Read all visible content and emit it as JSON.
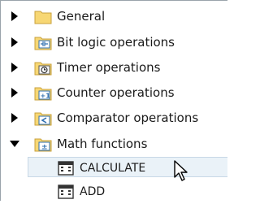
{
  "tree": {
    "items": [
      {
        "label": "General",
        "expanded": false,
        "icon": "folder-icon"
      },
      {
        "label": "Bit logic operations",
        "expanded": false,
        "icon": "bit-logic-icon"
      },
      {
        "label": "Timer operations",
        "expanded": false,
        "icon": "timer-icon"
      },
      {
        "label": "Counter operations",
        "expanded": false,
        "icon": "counter-icon"
      },
      {
        "label": "Comparator operations",
        "expanded": false,
        "icon": "comparator-icon"
      },
      {
        "label": "Math functions",
        "expanded": true,
        "icon": "math-icon",
        "children": [
          {
            "label": "CALCULATE",
            "icon": "instruction-block-icon",
            "selected": true
          },
          {
            "label": "ADD",
            "icon": "instruction-block-icon",
            "selected": false
          }
        ]
      }
    ]
  },
  "colors": {
    "folder": "#f7d774",
    "folder_border": "#c9a23c",
    "folder_icon_fill": "#ffe07a",
    "accent_blue": "#2f6fb0",
    "selection_fill": "#eaf2f8",
    "selection_border": "#c8d8e6"
  },
  "cursor": {
    "icon": "mouse-pointer-icon"
  }
}
